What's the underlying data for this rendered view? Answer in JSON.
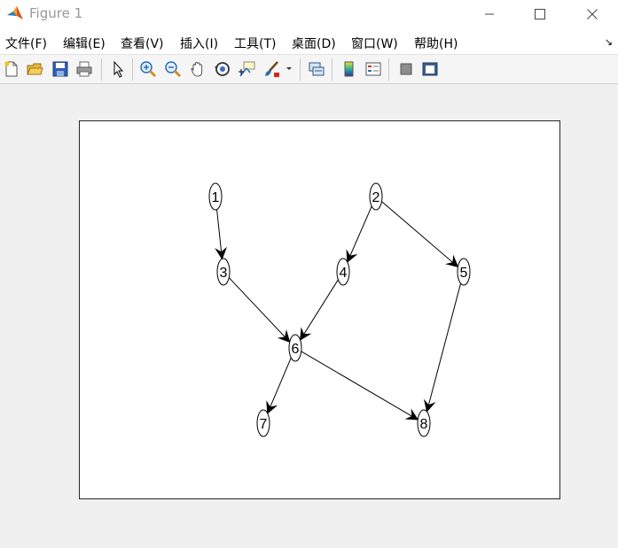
{
  "window": {
    "title": "Figure 1"
  },
  "menu": {
    "items": [
      "文件(F)",
      "编辑(E)",
      "查看(V)",
      "插入(I)",
      "工具(T)",
      "桌面(D)",
      "窗口(W)",
      "帮助(H)"
    ]
  },
  "toolbar": {
    "buttons": [
      "new-figure-icon",
      "open-file-icon",
      "save-icon",
      "print-icon",
      "edit-plot-icon",
      "zoom-in-icon",
      "zoom-out-icon",
      "pan-icon",
      "rotate-3d-icon",
      "data-cursor-icon",
      "brush-icon",
      "link-plot-icon",
      "colorbar-icon",
      "legend-icon",
      "hide-plot-tools-icon",
      "show-plot-tools-icon"
    ]
  },
  "graph": {
    "nodes": [
      {
        "id": "1",
        "label": "1"
      },
      {
        "id": "2",
        "label": "2"
      },
      {
        "id": "3",
        "label": "3"
      },
      {
        "id": "4",
        "label": "4"
      },
      {
        "id": "5",
        "label": "5"
      },
      {
        "id": "6",
        "label": "6"
      },
      {
        "id": "7",
        "label": "7"
      },
      {
        "id": "8",
        "label": "8"
      }
    ],
    "edges": [
      {
        "from": "1",
        "to": "3"
      },
      {
        "from": "2",
        "to": "4"
      },
      {
        "from": "2",
        "to": "5"
      },
      {
        "from": "3",
        "to": "6"
      },
      {
        "from": "4",
        "to": "6"
      },
      {
        "from": "5",
        "to": "8"
      },
      {
        "from": "6",
        "to": "7"
      },
      {
        "from": "6",
        "to": "8"
      }
    ]
  },
  "colors": {
    "edge": "#000000",
    "node_border": "#000000",
    "node_fill": "#ffffff"
  }
}
